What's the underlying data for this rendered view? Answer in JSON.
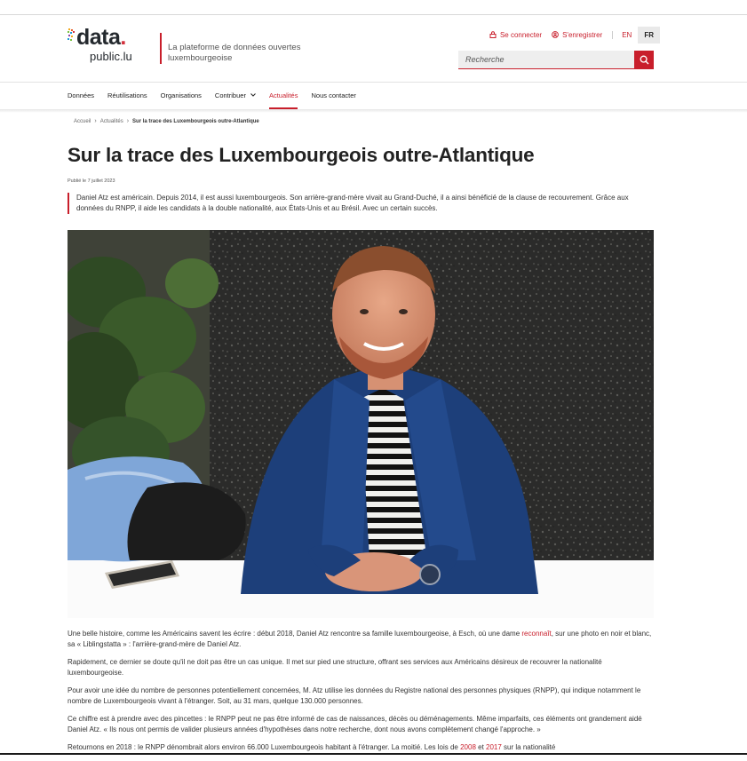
{
  "header": {
    "logo_main": "data",
    "logo_dot": ".",
    "logo_sub": "public.lu",
    "tagline": "La plateforme de données ouvertes luxembourgeoise",
    "login_label": "Se connecter",
    "register_label": "S'enregistrer",
    "languages": [
      "EN",
      "FR"
    ],
    "active_language": "FR",
    "search_placeholder": "Recherche"
  },
  "nav": {
    "items": [
      "Données",
      "Réutilisations",
      "Organisations",
      "Contribuer",
      "Actualités",
      "Nous contacter"
    ],
    "active": "Actualités"
  },
  "breadcrumb": [
    "Accueil",
    "Actualités",
    "Sur la trace des Luxembourgeois outre-Atlantique"
  ],
  "article": {
    "title": "Sur la trace des Luxembourgeois outre-Atlantique",
    "published": "Publié le 7 juillet 2023",
    "lead": "Daniel Atz est américain. Depuis 2014, il est aussi luxembourgeois. Son arrière-grand-mère vivait au Grand-Duché, il a ainsi bénéficié de la clause de recouvrement. Grâce aux données du RNPP, il aide les candidats à la double nationalité, aux États-Unis et au Brésil. Avec un certain succès.",
    "p1_before": "Une belle histoire, comme les Américains savent les écrire : début 2018, Daniel Atz rencontre sa famille luxembourgeoise, à Esch, où une dame ",
    "p1_link": "reconnaît",
    "p1_after": ", sur une photo en noir et blanc, sa « Liblingstatta » : l'arrière-grand-mère de Daniel Atz.",
    "p2": "Rapidement, ce dernier se doute qu'il ne doit pas être un cas unique. Il met sur pied une structure, offrant ses services aux Américains désireux de recouvrer la nationalité luxembourgeoise.",
    "p3": "Pour avoir une idée du nombre de personnes potentiellement concernées, M. Atz utilise les données du Registre national des personnes physiques (RNPP), qui indique notamment le nombre de Luxembourgeois vivant à l'étranger. Soit, au 31 mars, quelque 130.000 personnes.",
    "p4": "Ce chiffre est à prendre avec des pincettes : le RNPP peut ne pas être informé de cas de naissances, décès ou déménagements. Même imparfaits, ces éléments ont grandement aidé Daniel Atz. « Ils nous ont permis de valider plusieurs années d'hypothèses dans notre recherche, dont nous avons complètement changé l'approche. »",
    "p5_before": "Retournons en 2018 : le RNPP dénombrait alors environ 66.000 Luxembourgeois habitant à l'étranger. La moitié. Les lois de ",
    "p5_link1": "2008",
    "p5_mid": " et ",
    "p5_link2": "2017",
    "p5_after": " sur la nationalité"
  },
  "colors": {
    "accent": "#c81e2b",
    "text": "#222222"
  }
}
